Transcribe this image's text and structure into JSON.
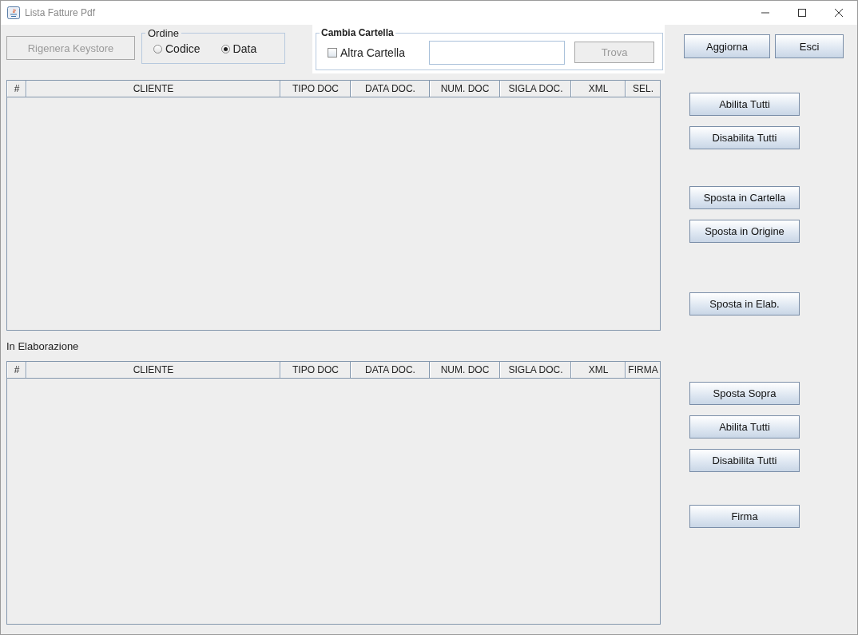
{
  "window": {
    "title": "Lista Fatture Pdf"
  },
  "toolbar": {
    "regenerate_button": {
      "label": "Rigenera Keystore",
      "disabled": true
    },
    "order": {
      "title": "Ordine",
      "options": [
        {
          "label": "Codice",
          "selected": false
        },
        {
          "label": "Data",
          "selected": true
        }
      ]
    },
    "change_folder": {
      "title": "Cambia Cartella",
      "other_folder": {
        "label": "Altra Cartella",
        "checked": false
      },
      "find_button": {
        "label": "Trova",
        "disabled": true
      }
    },
    "buttons": [
      {
        "label": "Aggiorna",
        "disabled": false
      },
      {
        "label": "Esci",
        "disabled": false
      }
    ]
  },
  "files_table": {
    "columns": [
      "#",
      "CLIENTE",
      "TIPO DOC",
      "DATA DOC.",
      "NUM. DOC",
      "SIGLA DOC.",
      "XML",
      "SEL."
    ]
  },
  "processing_label": "In Elaborazione",
  "processing_table": {
    "columns": [
      "#",
      "CLIENTE",
      "TIPO DOC",
      "DATA DOC.",
      "NUM. DOC",
      "SIGLA DOC.",
      "XML",
      "FIRMA"
    ]
  },
  "side_button_groups": [
    {
      "buttons": [
        {
          "label": "Abilita Tutti",
          "disabled": false
        },
        {
          "label": "Disabilita Tutti",
          "disabled": false
        }
      ]
    },
    {
      "buttons": [
        {
          "label": "Sposta in Cartella",
          "disabled": false
        },
        {
          "label": "Sposta in Origine",
          "disabled": false
        }
      ]
    },
    {
      "buttons": [
        {
          "label": "Sposta in Elab.",
          "disabled": false
        }
      ]
    },
    {
      "buttons": [
        {
          "label": "Sposta Sopra",
          "disabled": false
        },
        {
          "label": "Abilita Tutti",
          "disabled": false
        },
        {
          "label": "Disabilita Tutti",
          "disabled": false
        }
      ]
    },
    {
      "buttons": [
        {
          "label": "Firma",
          "disabled": false
        }
      ]
    }
  ]
}
